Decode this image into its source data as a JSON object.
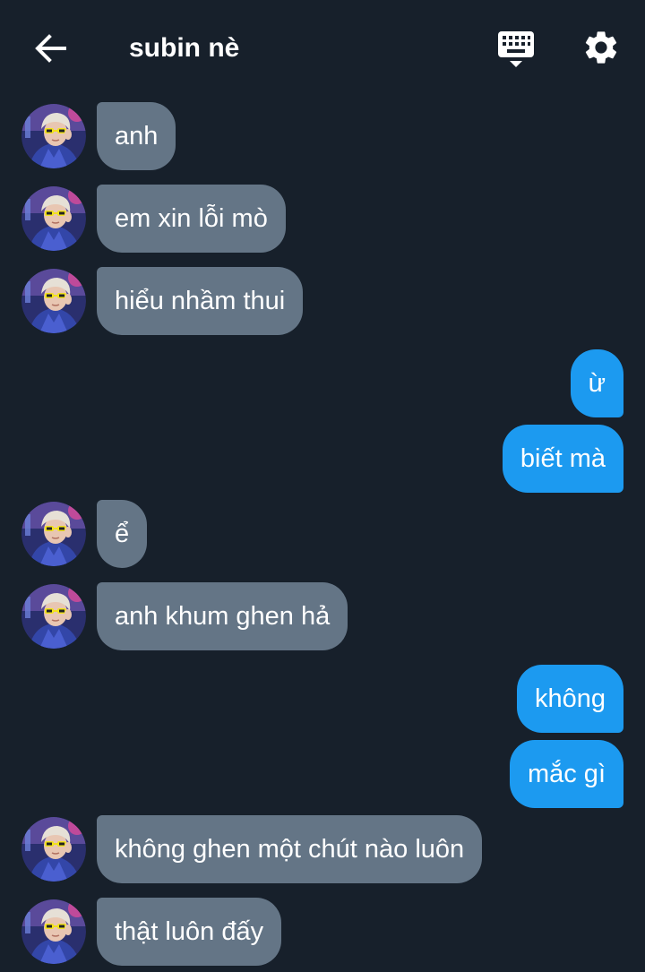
{
  "header": {
    "title": "subin nè",
    "back_icon": "arrow-left-icon",
    "keyboard_icon": "keyboard-icon",
    "settings_icon": "gear-icon"
  },
  "colors": {
    "background": "#17202b",
    "incoming_bubble": "#647586",
    "outgoing_bubble": "#1c9af0",
    "text": "#ffffff"
  },
  "messages": [
    {
      "side": "in",
      "text": "anh"
    },
    {
      "side": "in",
      "text": "em xin lỗi mò"
    },
    {
      "side": "in",
      "text": "hiểu nhầm thui"
    },
    {
      "side": "out",
      "text": "ừ"
    },
    {
      "side": "out",
      "text": "biết mà"
    },
    {
      "side": "in",
      "text": "ể"
    },
    {
      "side": "in",
      "text": "anh khum ghen hả"
    },
    {
      "side": "out",
      "text": "không"
    },
    {
      "side": "out",
      "text": "mắc gì"
    },
    {
      "side": "in",
      "text": "không ghen một chút nào luôn"
    },
    {
      "side": "in",
      "text": "thật luôn đấy"
    }
  ]
}
